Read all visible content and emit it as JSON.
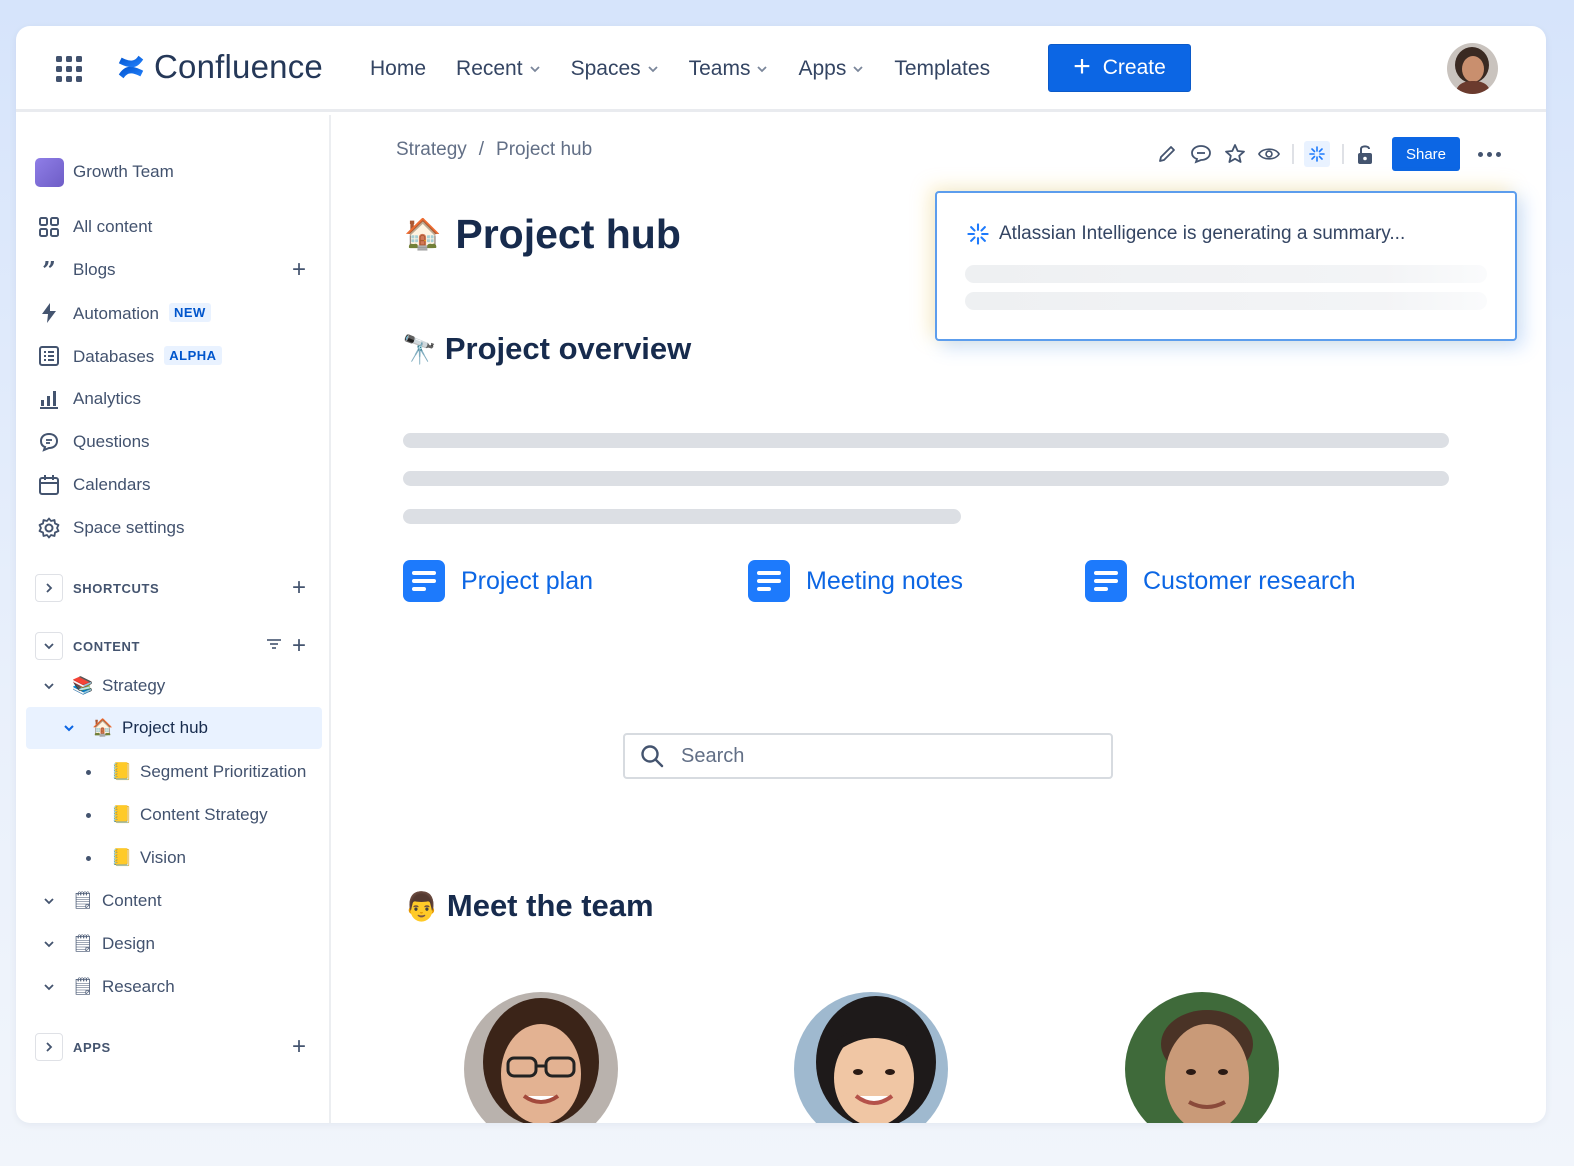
{
  "app": {
    "name": "Confluence"
  },
  "topnav": {
    "items": [
      {
        "label": "Home",
        "dropdown": false
      },
      {
        "label": "Recent",
        "dropdown": true
      },
      {
        "label": "Spaces",
        "dropdown": true
      },
      {
        "label": "Teams",
        "dropdown": true
      },
      {
        "label": "Apps",
        "dropdown": true
      },
      {
        "label": "Templates",
        "dropdown": false
      }
    ],
    "create_label": "Create"
  },
  "sidebar": {
    "space_name": "Growth Team",
    "items": [
      {
        "label": "All content",
        "icon": "grid-icon"
      },
      {
        "label": "Blogs",
        "icon": "quote-icon"
      },
      {
        "label": "Automation",
        "icon": "lightning-icon",
        "badge": "NEW"
      },
      {
        "label": "Databases",
        "icon": "database-icon",
        "badge": "ALPHA"
      },
      {
        "label": "Analytics",
        "icon": "bar-chart-icon"
      },
      {
        "label": "Questions",
        "icon": "speech-bubble-icon"
      },
      {
        "label": "Calendars",
        "icon": "calendar-icon"
      },
      {
        "label": "Space settings",
        "icon": "gear-icon"
      }
    ],
    "sections": {
      "shortcuts": "SHORTCUTS",
      "content": "CONTENT",
      "apps": "APPS"
    },
    "tree": {
      "strategy": "Strategy",
      "project_hub": "Project hub",
      "children": [
        "Segment Prioritization",
        "Content Strategy",
        "Vision"
      ],
      "folders": [
        "Content",
        "Design",
        "Research"
      ]
    }
  },
  "breadcrumb": [
    "Strategy",
    "/",
    "Project hub"
  ],
  "toolbar": {
    "share_label": "Share"
  },
  "ai_summary": {
    "text": "Atlassian Intelligence is generating a summary..."
  },
  "page": {
    "title": "Project hub",
    "overview_heading": "Project overview",
    "links": [
      "Project plan",
      "Meeting notes",
      "Customer research"
    ],
    "search_placeholder": "Search",
    "team_heading": "Meet the team"
  },
  "colors": {
    "brand": "#0c66e4",
    "active_bg": "#e9f2ff",
    "space_avatar": "#7f6fd8"
  }
}
